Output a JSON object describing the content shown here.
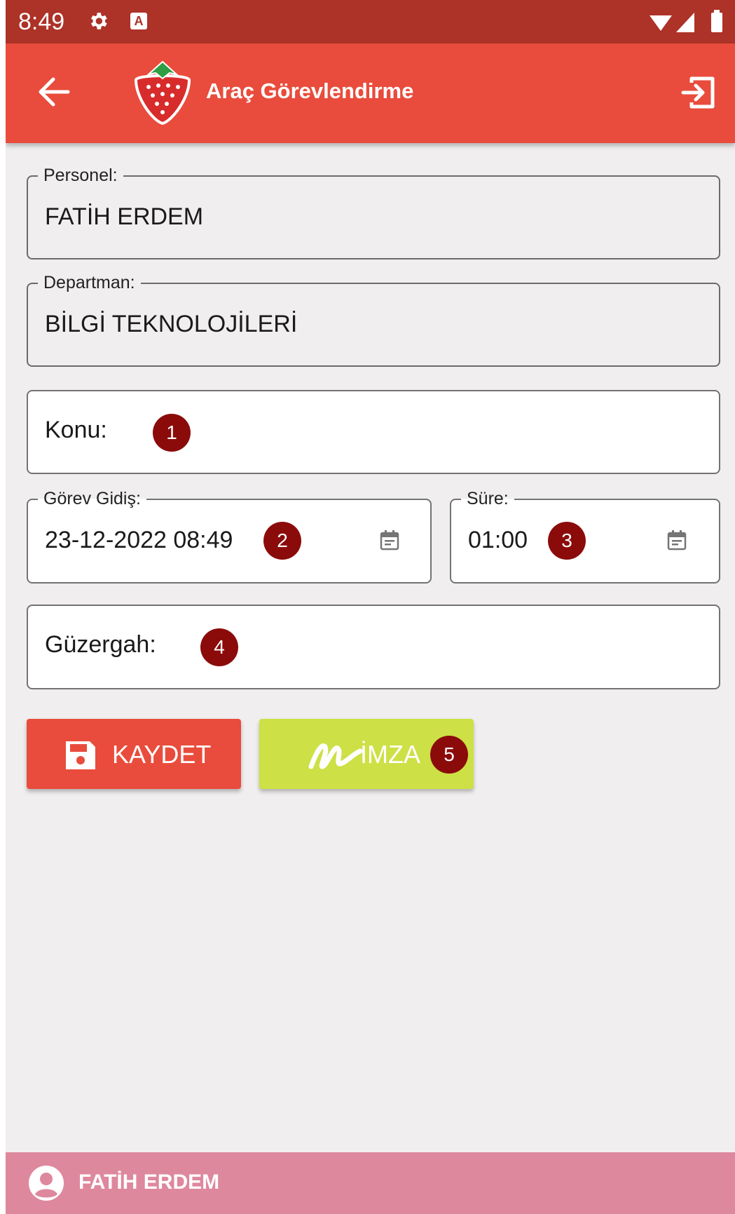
{
  "status_bar": {
    "time": "8:49",
    "icons": [
      "settings-gear-icon",
      "a-keyboard-icon",
      "wifi-icon",
      "signal-icon",
      "battery-icon"
    ]
  },
  "app_bar": {
    "title": "Araç Görevlendirme",
    "back_icon": "arrow-left-icon",
    "logo_icon": "strawberry-logo",
    "logout_icon": "logout-icon",
    "color": "#e94c3c"
  },
  "form": {
    "personel": {
      "label": "Personel:",
      "value": "FATİH ERDEM"
    },
    "departman": {
      "label": "Departman:",
      "value": "BİLGİ TEKNOLOJİLERİ"
    },
    "konu": {
      "placeholder": "Konu:",
      "badge": "1"
    },
    "gorev_gidis": {
      "label": "Görev Gidiş:",
      "value": "23-12-2022 08:49",
      "badge": "2"
    },
    "sure": {
      "label": "Süre:",
      "value": "01:00",
      "badge": "3"
    },
    "guzergah": {
      "placeholder": "Güzergah:",
      "badge": "4"
    }
  },
  "buttons": {
    "save": {
      "label": "KAYDET",
      "icon": "floppy-save-icon",
      "color": "#e94c3c"
    },
    "sign": {
      "label": "İMZA",
      "icon": "signature-icon",
      "badge": "5",
      "color": "#cde045"
    }
  },
  "footer": {
    "user": "FATİH ERDEM",
    "icon": "user-avatar-icon",
    "color": "#de889d"
  }
}
